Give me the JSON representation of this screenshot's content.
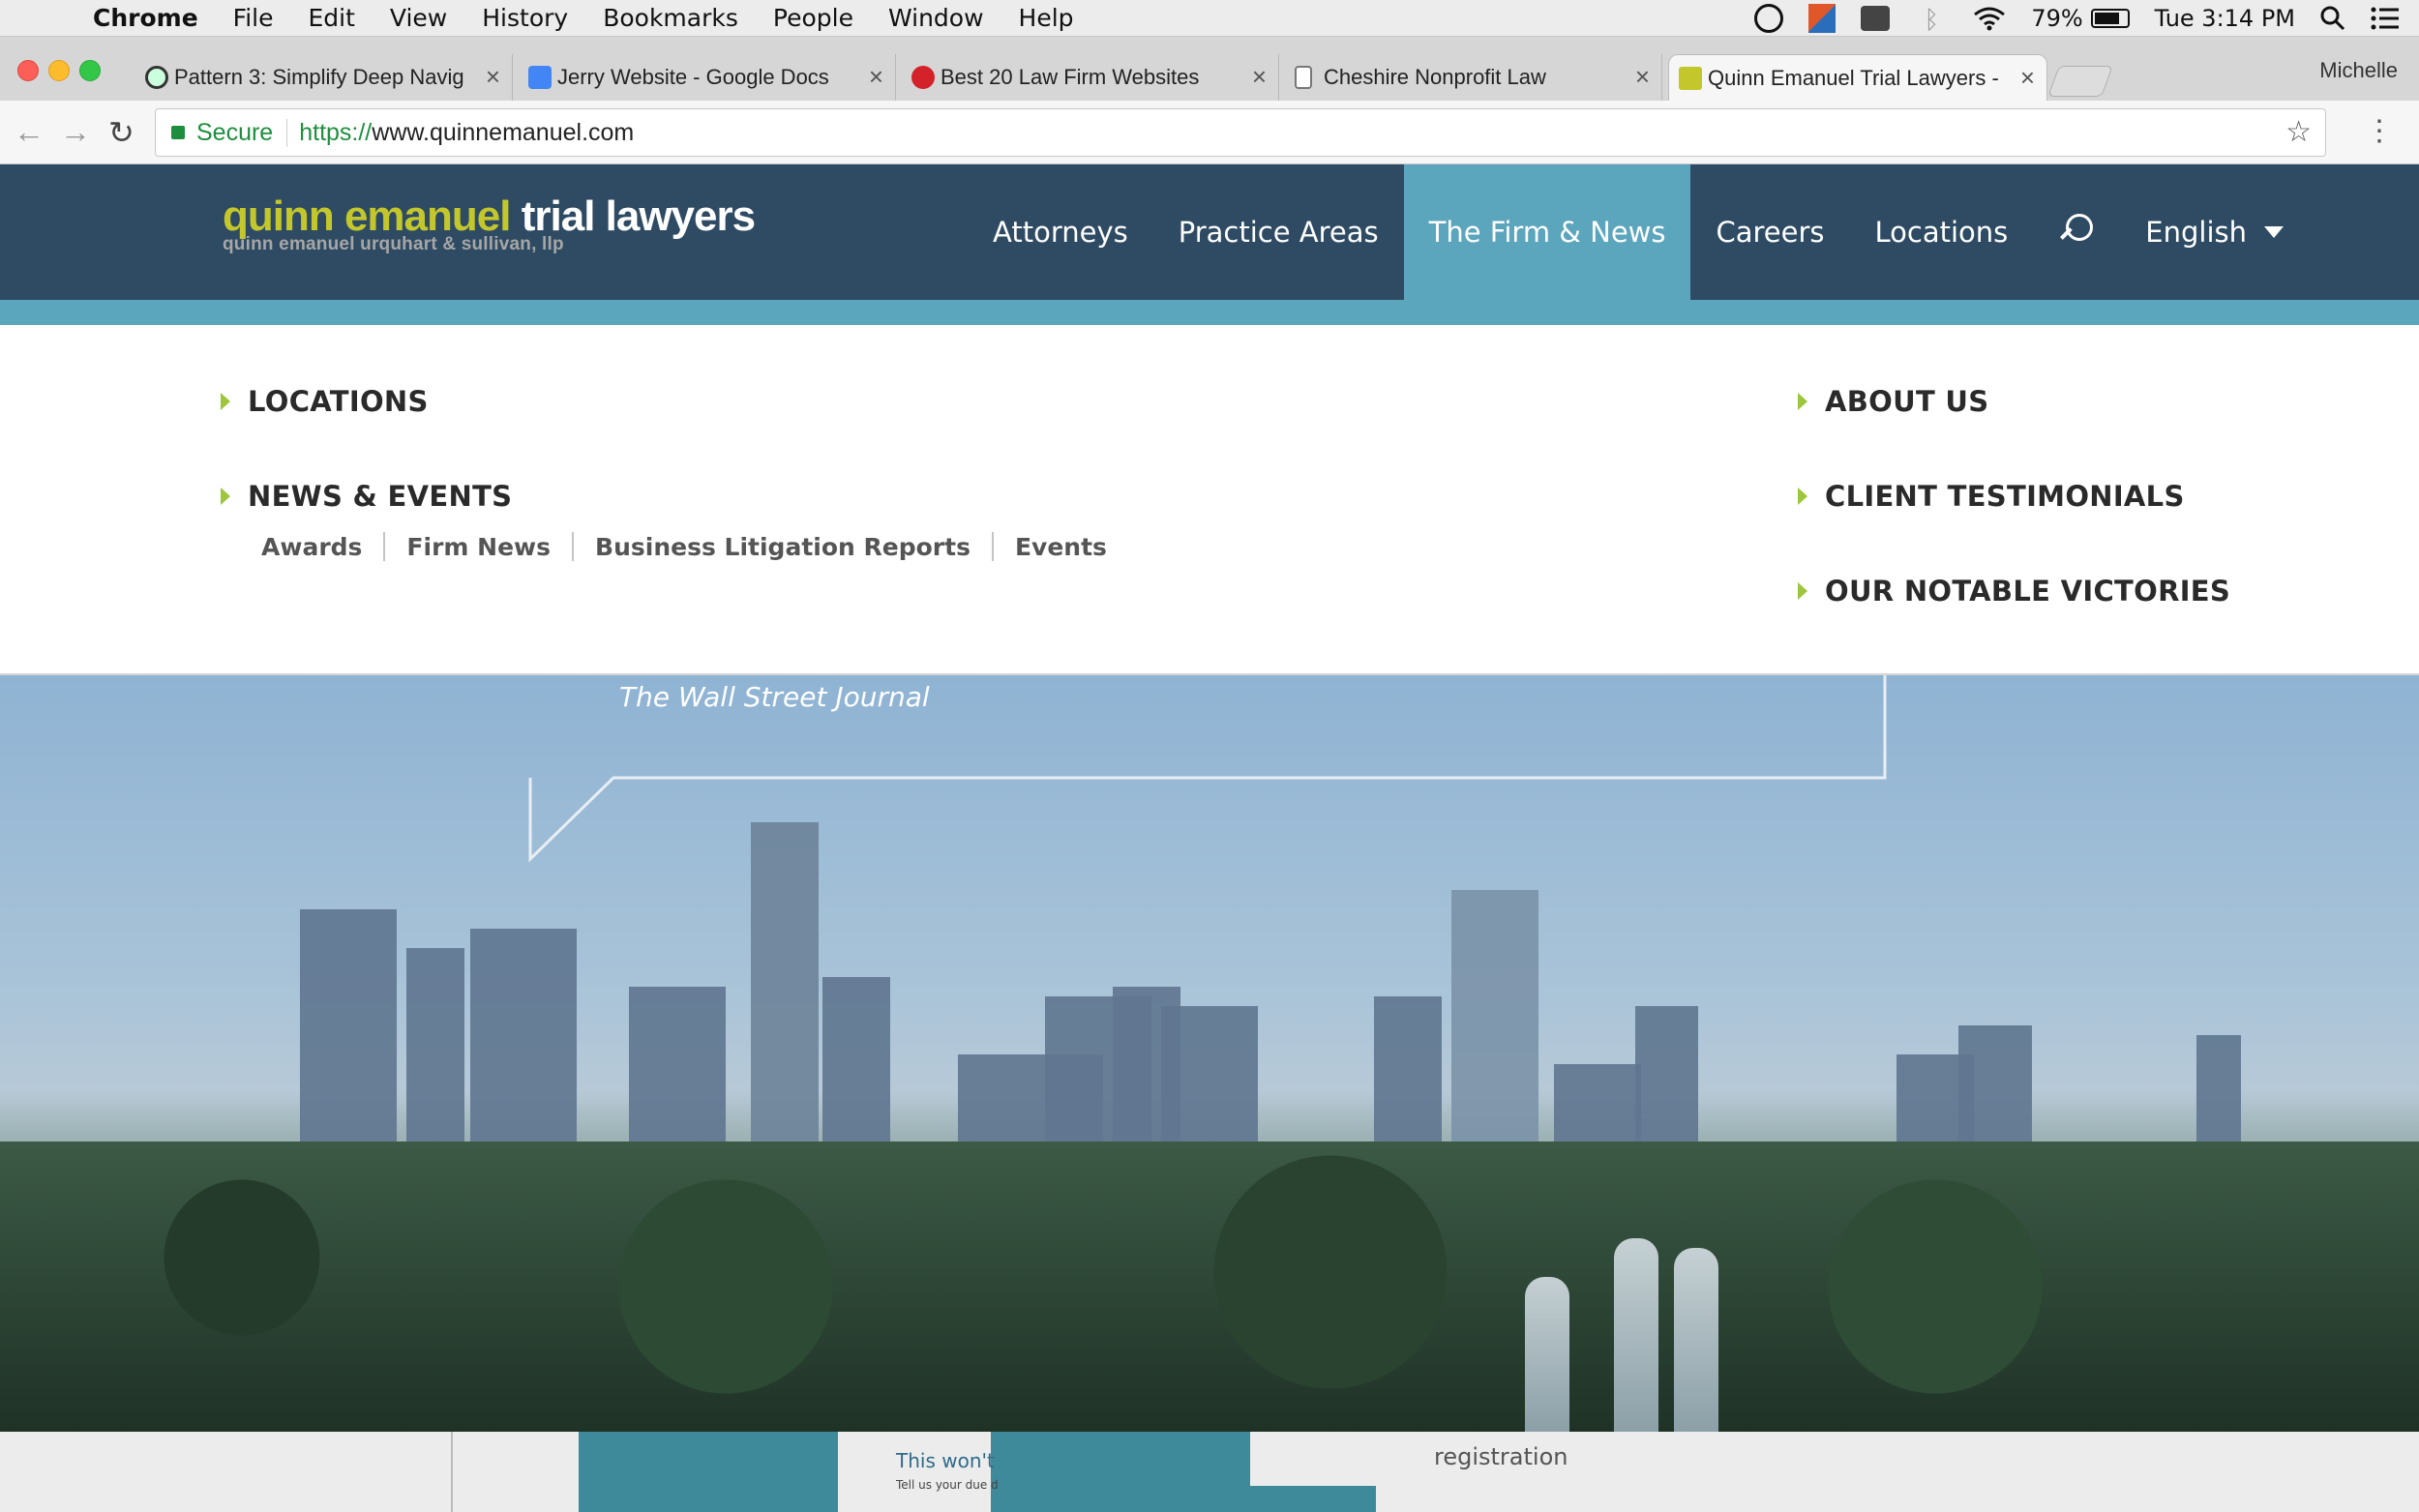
{
  "menubar": {
    "app": "Chrome",
    "items": [
      "File",
      "Edit",
      "View",
      "History",
      "Bookmarks",
      "People",
      "Window",
      "Help"
    ],
    "battery": "79%",
    "clock": "Tue 3:14 PM",
    "battery_level": 0.79
  },
  "tabs": [
    {
      "title": "Pattern 3: Simplify Deep Navig"
    },
    {
      "title": "Jerry Website - Google Docs"
    },
    {
      "title": "Best 20 Law Firm Websites"
    },
    {
      "title": "Cheshire Nonprofit Law"
    },
    {
      "title": "Quinn Emanuel Trial Lawyers -"
    }
  ],
  "profile": "Michelle",
  "address": {
    "secure_label": "Secure",
    "scheme": "https://",
    "host": "www.quinnemanuel.com"
  },
  "logo": {
    "part1": "quinn emanuel",
    "part2": "trial lawyers",
    "subline": "quinn emanuel urquhart & sullivan, llp"
  },
  "nav": {
    "items": [
      "Attorneys",
      "Practice Areas",
      "The Firm & News",
      "Careers",
      "Locations"
    ],
    "language": "English"
  },
  "dropdown": {
    "left": [
      "LOCATIONS",
      "NEWS & EVENTS"
    ],
    "sublinks": [
      "Awards",
      "Firm News",
      "Business Litigation Reports",
      "Events"
    ],
    "right": [
      "ABOUT US",
      "CLIENT TESTIMONIALS",
      "OUR NOTABLE VICTORIES"
    ]
  },
  "hero": {
    "quote_source": "The Wall Street Journal"
  },
  "bottom": {
    "registration": "registration",
    "wont": "This won't",
    "tell": "Tell us your due d"
  },
  "colors": {
    "header_bg": "#2e4b63",
    "accent": "#5ba5bd",
    "logo_green": "#c3c72b",
    "arrow_green": "#9cc63b"
  }
}
